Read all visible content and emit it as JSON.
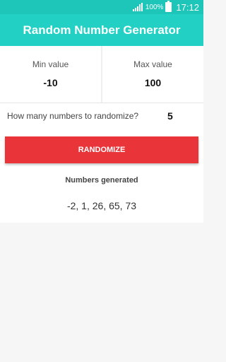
{
  "status_bar": {
    "battery_percent": "100%",
    "time": "17:12",
    "icons": [
      "signal-icon",
      "battery-icon"
    ]
  },
  "app_bar": {
    "title": "Random Number Generator",
    "color": "#22d1c4"
  },
  "range": {
    "min_label": "Min value",
    "min_value": "-10",
    "max_label": "Max value",
    "max_value": "100"
  },
  "count": {
    "question": "How many numbers to randomize?",
    "value": "5"
  },
  "randomize_button": {
    "label": "RANDOMIZE",
    "color": "#e9343a"
  },
  "results": {
    "title": "Numbers generated",
    "values": "-2, 1, 26, 65, 73"
  }
}
